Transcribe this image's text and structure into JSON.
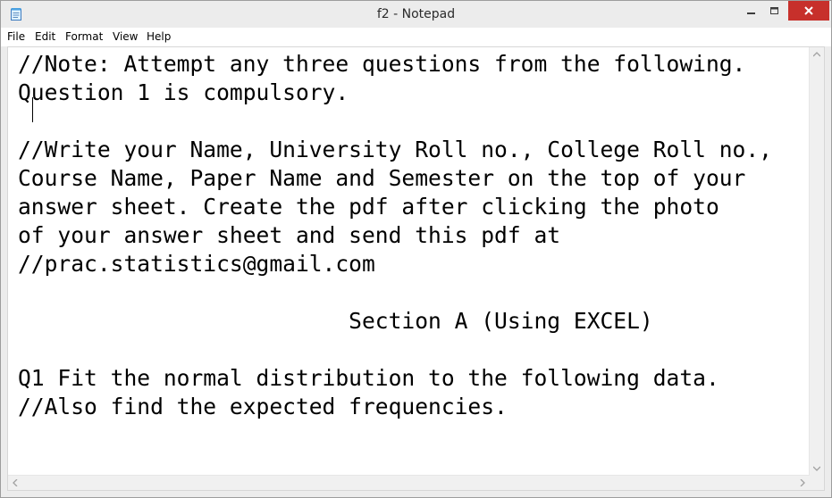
{
  "window": {
    "title": "f2 - Notepad"
  },
  "menu": {
    "items": [
      "File",
      "Edit",
      "Format",
      "View",
      "Help"
    ]
  },
  "editor": {
    "lines": [
      "//Note: Attempt any three questions from the following.",
      "Question 1 is compulsory.",
      "",
      "//Write your Name, University Roll no., College Roll no.,",
      "Course Name, Paper Name and Semester on the top of your",
      "answer sheet. Create the pdf after clicking the photo",
      "of your answer sheet and send this pdf at",
      "//prac.statistics@gmail.com",
      "",
      "                         Section A (Using EXCEL)",
      "",
      "Q1 Fit the normal distribution to the following data.",
      "//Also find the expected frequencies."
    ]
  },
  "icons": {
    "app": "notepad-icon",
    "minimize": "minimize-icon",
    "maximize": "maximize-icon",
    "close": "close-icon",
    "scroll_up": "arrow-up-icon",
    "scroll_down": "arrow-down-icon",
    "scroll_left": "arrow-left-icon",
    "scroll_right": "arrow-right-icon"
  },
  "colors": {
    "close_button": "#c7302b",
    "titlebar": "#ececec",
    "text": "#000000"
  }
}
